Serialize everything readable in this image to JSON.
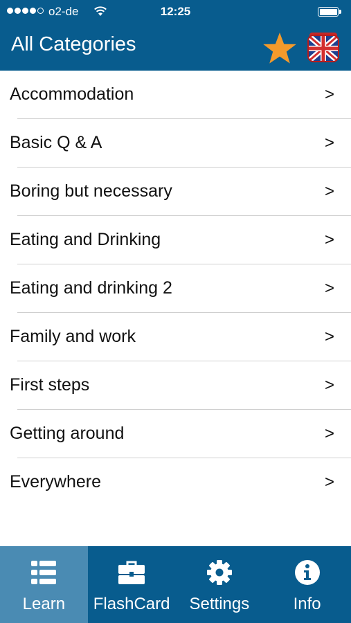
{
  "status": {
    "carrier": "o2-de",
    "time": "12:25"
  },
  "header": {
    "title": "All Categories",
    "favorite_icon": "star-icon",
    "language_icon": "uk-flag-icon"
  },
  "categories": [
    {
      "label": "Accommodation",
      "chevron": ">"
    },
    {
      "label": "Basic Q & A",
      "chevron": ">"
    },
    {
      "label": "Boring but necessary",
      "chevron": ">"
    },
    {
      "label": "Eating and Drinking",
      "chevron": ">"
    },
    {
      "label": "Eating and drinking 2",
      "chevron": ">"
    },
    {
      "label": "Family and work",
      "chevron": ">"
    },
    {
      "label": "First steps",
      "chevron": ">"
    },
    {
      "label": "Getting around",
      "chevron": ">"
    },
    {
      "label": "Everywhere",
      "chevron": ">"
    }
  ],
  "tabs": [
    {
      "label": "Learn",
      "icon": "list-icon",
      "active": true
    },
    {
      "label": "FlashCard",
      "icon": "briefcase-icon",
      "active": false
    },
    {
      "label": "Settings",
      "icon": "gear-icon",
      "active": false
    },
    {
      "label": "Info",
      "icon": "info-icon",
      "active": false
    }
  ],
  "colors": {
    "header_bg": "#085c8e",
    "active_tab_bg": "#4a8bb3",
    "star": "#f39a2b"
  }
}
